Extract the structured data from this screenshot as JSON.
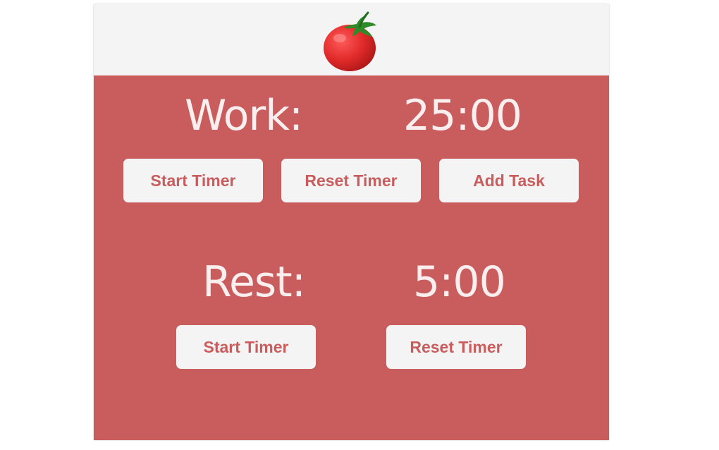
{
  "app": {
    "logo_icon": "tomato-icon"
  },
  "work": {
    "label": "Work:",
    "time": "25:00",
    "start_label": "Start Timer",
    "reset_label": "Reset Timer",
    "add_task_label": "Add Task"
  },
  "rest": {
    "label": "Rest:",
    "time": "5:00",
    "start_label": "Start Timer",
    "reset_label": "Reset Timer"
  },
  "colors": {
    "panel": "#c95d5d",
    "button_bg": "#f4f4f4",
    "button_text": "#c95d5d",
    "timer_text": "#fbeeee"
  }
}
